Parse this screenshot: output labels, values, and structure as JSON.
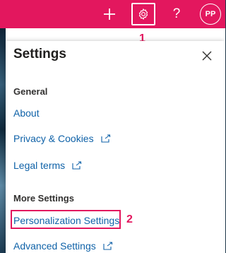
{
  "topbar": {
    "icons": [
      "plus-icon",
      "gear-icon",
      "help-icon"
    ],
    "help_glyph": "?",
    "avatar_initials": "PP",
    "accent_color": "#e3175e"
  },
  "callouts": {
    "first": "1",
    "second": "2"
  },
  "panel": {
    "title": "Settings",
    "general": {
      "heading": "General",
      "about": "About",
      "privacy": "Privacy & Cookies",
      "legal": "Legal terms"
    },
    "more": {
      "heading": "More Settings",
      "personalization": "Personalization Settings",
      "advanced": "Advanced Settings"
    }
  }
}
